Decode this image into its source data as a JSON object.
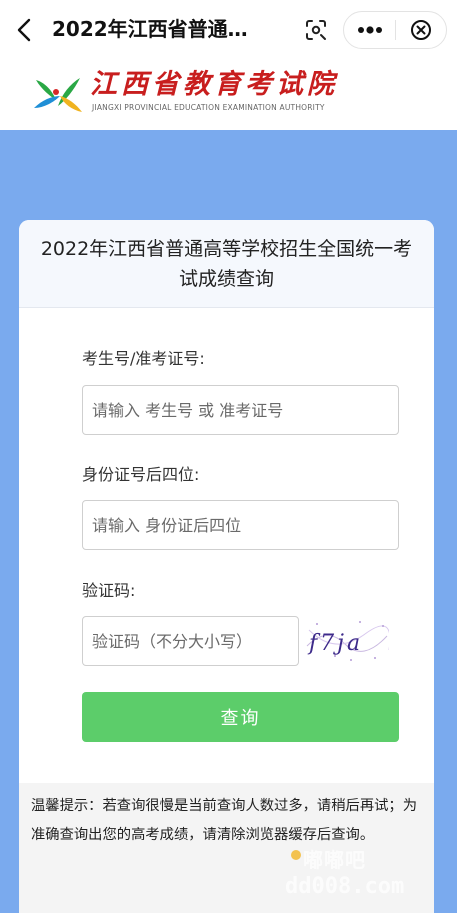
{
  "navbar": {
    "title": "2022年江西省普通…",
    "back_icon": "chevron-left-icon",
    "scan_icon": "scan-icon",
    "more_icon": "more-dots-icon",
    "close_icon": "close-circle-icon"
  },
  "header": {
    "logo_cn": "江西省教育考试院",
    "logo_en": "JIANGXI PROVINCIAL EDUCATION EXAMINATION AUTHORITY"
  },
  "card": {
    "title": "2022年江西省普通高等学校招生全国统一考试成绩查询"
  },
  "form": {
    "exam_id_label": "考生号/准考证号:",
    "exam_id_placeholder": "请输入 考生号 或 准考证号",
    "exam_id_value": "",
    "id_card_label": "身份证号后四位:",
    "id_card_placeholder": "请输入 身份证后四位",
    "id_card_value": "",
    "captcha_label": "验证码:",
    "captcha_placeholder": "验证码（不分大小写）",
    "captcha_value": "",
    "captcha_image_text": "f7ja",
    "submit_label": "查询"
  },
  "tip": {
    "text": "温馨提示：若查询很慢是当前查询人数过多，请稍后再试；为准确查询出您的高考成绩，请清除浏览器缓存后查询。"
  },
  "watermark": {
    "cn": "嘟嘟吧",
    "en": "dd008.com"
  },
  "colors": {
    "background_blue": "#7aaaee",
    "button_green": "#5ccd6a",
    "logo_red": "#c81e1e",
    "card_head_bg": "#f5f8fd",
    "tip_bg": "#f4f4f4"
  }
}
